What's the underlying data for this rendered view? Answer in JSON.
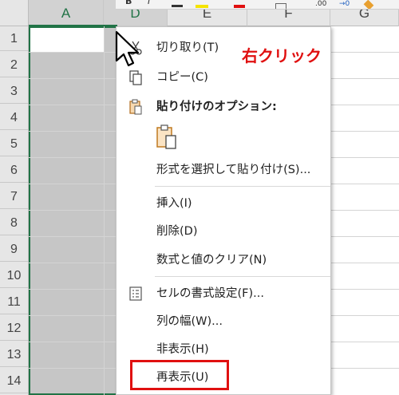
{
  "columns": [
    {
      "label": "A"
    },
    {
      "label": "D"
    },
    {
      "label": "E"
    },
    {
      "label": "F"
    },
    {
      "label": "G"
    }
  ],
  "rows": [
    "1",
    "2",
    "3",
    "4",
    "5",
    "6",
    "7",
    "8",
    "9",
    "10",
    "11",
    "12",
    "13",
    "14"
  ],
  "menu": {
    "cut": "切り取り(T)",
    "copy": "コピー(C)",
    "paste_options": "貼り付けのオプション:",
    "paste_special": "形式を選択して貼り付け(S)...",
    "insert": "挿入(I)",
    "delete": "削除(D)",
    "clear": "数式と値のクリア(N)",
    "format_cells": "セルの書式設定(F)...",
    "column_width": "列の幅(W)...",
    "hide": "非表示(H)",
    "unhide": "再表示(U)"
  },
  "annotation": "右クリック",
  "colors": {
    "selection_border": "#217346",
    "highlight_red": "#e01010"
  },
  "icons": {
    "cut": "scissors-icon",
    "copy": "copy-icon",
    "paste": "clipboard-icon",
    "format_cells": "format-cells-icon",
    "cursor": "mouse-cursor-icon"
  }
}
